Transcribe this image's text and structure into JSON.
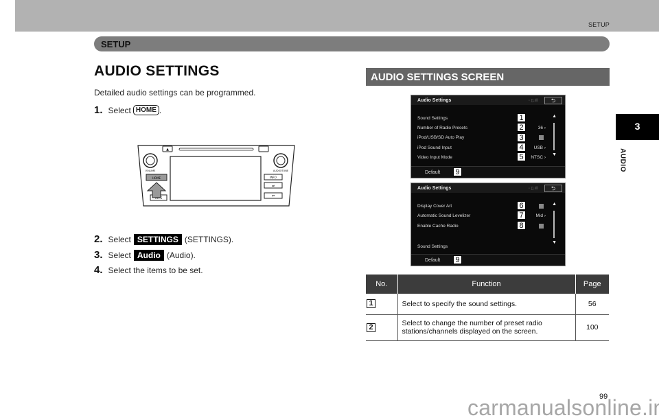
{
  "header": {
    "section_label": "SETUP",
    "chapter_bar": "SETUP"
  },
  "side_tab": {
    "chapter_number": "3",
    "chapter_name": "AUDIO"
  },
  "left": {
    "title": "AUDIO SETTINGS",
    "intro": "Detailed audio settings can be programmed.",
    "steps": [
      {
        "num": "1.",
        "pre": "Select",
        "key": "HOME",
        "post": "."
      },
      {
        "num": "2.",
        "pre": "Select",
        "key": "SETTINGS",
        "post": "(SETTINGS)."
      },
      {
        "num": "3.",
        "pre": "Select",
        "key": "Audio",
        "post": "(Audio)."
      },
      {
        "num": "4.",
        "pre": "Select the items to be set.",
        "key": "",
        "post": ""
      }
    ],
    "unit_labels": {
      "volume": "VOLUME",
      "audio_tune": "AUDIO/TUNE",
      "home": "HOME",
      "apps": "APPS",
      "info": "INFO"
    }
  },
  "right": {
    "title": "AUDIO SETTINGS SCREEN",
    "screen1": {
      "title": "Audio Settings",
      "rows": [
        {
          "label": "Sound Settings",
          "value": "",
          "callout": "1"
        },
        {
          "label": "Number of Radio Presets",
          "value": "36 ›",
          "callout": "2"
        },
        {
          "label": "iPod/USB/SD Auto Play",
          "value": "check",
          "callout": "3"
        },
        {
          "label": "iPod Sound Input",
          "value": "USB ›",
          "callout": "4"
        },
        {
          "label": "Video Input Mode",
          "value": "NTSC ›",
          "callout": "5"
        }
      ],
      "default_label": "Default",
      "default_callout": "9"
    },
    "screen2": {
      "title": "Audio Settings",
      "rows": [
        {
          "label": "Display Cover Art",
          "value": "check",
          "callout": "6"
        },
        {
          "label": "Automatic Sound Levelizer",
          "value": "Mid ›",
          "callout": "7"
        },
        {
          "label": "Enable Cache Radio",
          "value": "check",
          "callout": "8"
        },
        {
          "label": "Sound Settings",
          "value": "",
          "callout": ""
        }
      ],
      "default_label": "Default",
      "default_callout": "9"
    },
    "table": {
      "headers": [
        "No.",
        "Function",
        "Page"
      ],
      "rows": [
        {
          "no": "1",
          "function": "Select to specify the sound settings.",
          "page": "56"
        },
        {
          "no": "2",
          "function": "Select to change the number of preset radio stations/channels displayed on the screen.",
          "page": "100"
        }
      ]
    }
  },
  "footer": {
    "page_number": "99",
    "watermark": "carmanualsonline.info"
  }
}
